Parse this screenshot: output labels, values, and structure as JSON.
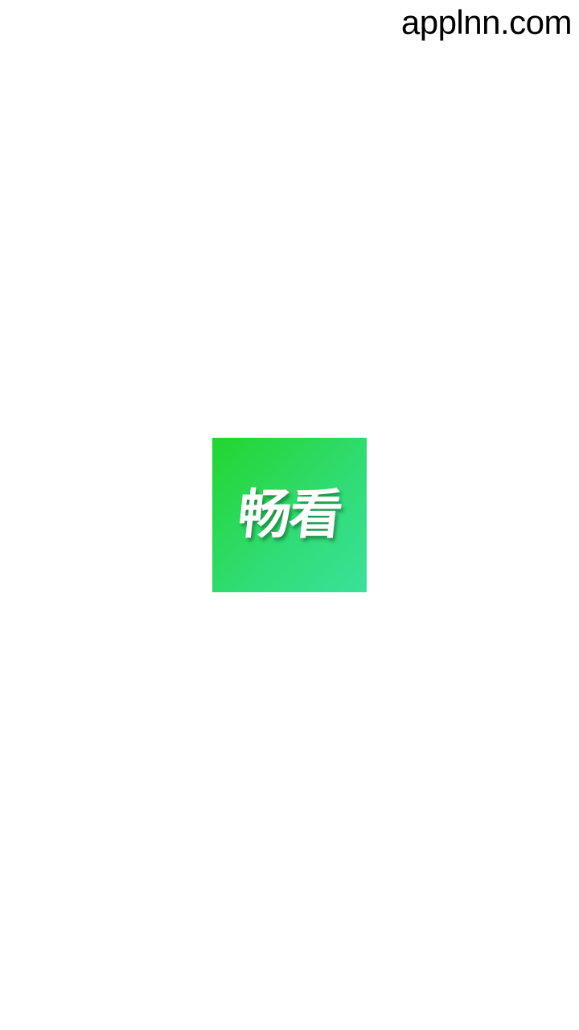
{
  "watermark": "applnn.com",
  "splash": {
    "logo_text": "畅看",
    "colors": {
      "gradient_start": "#22d62e",
      "gradient_end": "#3ae19a",
      "text": "#ffffff",
      "background": "#ffffff"
    }
  }
}
